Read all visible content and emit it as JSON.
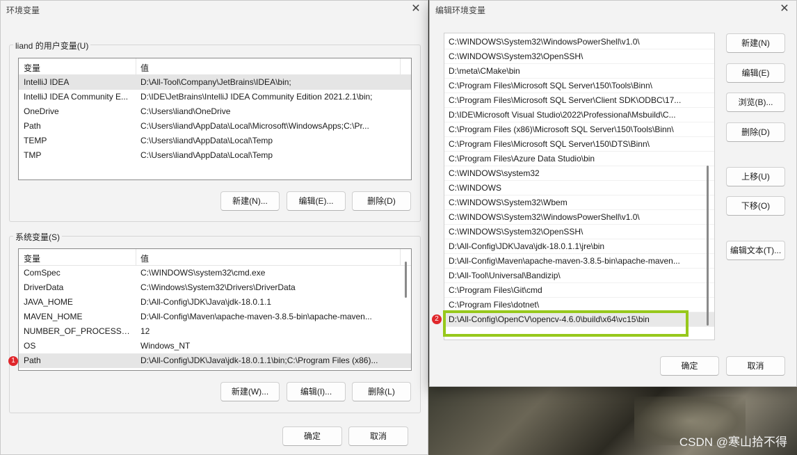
{
  "left_dialog": {
    "title": "环境变量",
    "user_group_label": "liand 的用户变量(U)",
    "columns": [
      "变量",
      "值"
    ],
    "user_rows": [
      {
        "name": "IntelliJ IDEA",
        "value": "D:\\All-Tool\\Company\\JetBrains\\IDEA\\bin;"
      },
      {
        "name": "IntelliJ IDEA Community E...",
        "value": "D:\\IDE\\JetBrains\\IntelliJ IDEA Community Edition 2021.2.1\\bin;"
      },
      {
        "name": "OneDrive",
        "value": "C:\\Users\\liand\\OneDrive"
      },
      {
        "name": "Path",
        "value": "C:\\Users\\liand\\AppData\\Local\\Microsoft\\WindowsApps;C:\\Pr..."
      },
      {
        "name": "TEMP",
        "value": "C:\\Users\\liand\\AppData\\Local\\Temp"
      },
      {
        "name": "TMP",
        "value": "C:\\Users\\liand\\AppData\\Local\\Temp"
      }
    ],
    "user_buttons": {
      "new": "新建(N)...",
      "edit": "编辑(E)...",
      "delete": "删除(D)"
    },
    "system_group_label": "系统变量(S)",
    "system_rows": [
      {
        "name": "ComSpec",
        "value": "C:\\WINDOWS\\system32\\cmd.exe"
      },
      {
        "name": "DriverData",
        "value": "C:\\Windows\\System32\\Drivers\\DriverData"
      },
      {
        "name": "JAVA_HOME",
        "value": "D:\\All-Config\\JDK\\Java\\jdk-18.0.1.1"
      },
      {
        "name": "MAVEN_HOME",
        "value": "D:\\All-Config\\Maven\\apache-maven-3.8.5-bin\\apache-maven..."
      },
      {
        "name": "NUMBER_OF_PROCESSORS",
        "value": "12"
      },
      {
        "name": "OS",
        "value": "Windows_NT"
      },
      {
        "name": "Path",
        "value": "D:\\All-Config\\JDK\\Java\\jdk-18.0.1.1\\bin;C:\\Program Files (x86)..."
      }
    ],
    "system_buttons": {
      "new": "新建(W)...",
      "edit": "编辑(I)...",
      "delete": "删除(L)"
    },
    "ok": "确定",
    "cancel": "取消",
    "badge": "1"
  },
  "right_dialog": {
    "title": "编辑环境变量",
    "paths": [
      "C:\\WINDOWS\\System32\\WindowsPowerShell\\v1.0\\",
      "C:\\WINDOWS\\System32\\OpenSSH\\",
      "D:\\meta\\CMake\\bin",
      "C:\\Program Files\\Microsoft SQL Server\\150\\Tools\\Binn\\",
      "C:\\Program Files\\Microsoft SQL Server\\Client SDK\\ODBC\\17...",
      "D:\\IDE\\Microsoft Visual Studio\\2022\\Professional\\Msbuild\\C...",
      "C:\\Program Files (x86)\\Microsoft SQL Server\\150\\Tools\\Binn\\",
      "C:\\Program Files\\Microsoft SQL Server\\150\\DTS\\Binn\\",
      "C:\\Program Files\\Azure Data Studio\\bin",
      "C:\\WINDOWS\\system32",
      "C:\\WINDOWS",
      "C:\\WINDOWS\\System32\\Wbem",
      "C:\\WINDOWS\\System32\\WindowsPowerShell\\v1.0\\",
      "C:\\WINDOWS\\System32\\OpenSSH\\",
      "D:\\All-Config\\JDK\\Java\\jdk-18.0.1.1\\jre\\bin",
      "D:\\All-Config\\Maven\\apache-maven-3.8.5-bin\\apache-maven...",
      "D:\\All-Tool\\Universal\\Bandizip\\",
      "C:\\Program Files\\Git\\cmd",
      "C:\\Program Files\\dotnet\\",
      "D:\\All-Config\\OpenCV\\opencv-4.6.0\\build\\x64\\vc15\\bin"
    ],
    "buttons": {
      "new": "新建(N)",
      "edit": "编辑(E)",
      "browse": "浏览(B)...",
      "delete": "删除(D)",
      "move_up": "上移(U)",
      "move_down": "下移(O)",
      "edit_text": "编辑文本(T)..."
    },
    "ok": "确定",
    "cancel": "取消",
    "badge": "2"
  },
  "watermark": "CSDN @寒山拾不得",
  "colors": {
    "highlight": "#97c81c",
    "badge": "#e0272c"
  }
}
